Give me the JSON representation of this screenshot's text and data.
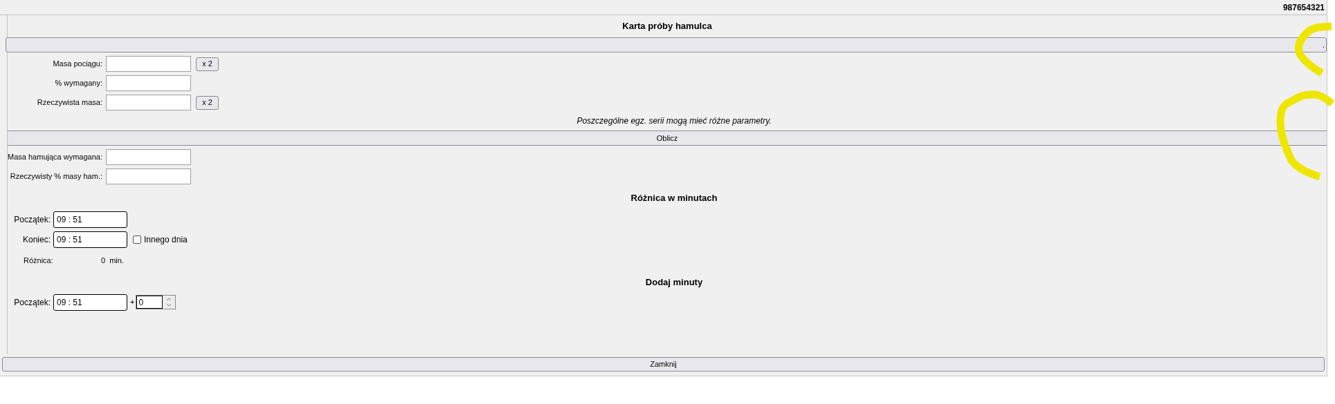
{
  "version": "987654321",
  "title": "Karta próby hamulca",
  "top_button": {
    "label": "."
  },
  "mass_fields": [
    {
      "label": "Masa pociągu:",
      "double_button": "x 2"
    },
    {
      "label": "% wymagany:"
    },
    {
      "label": "Rzeczywista masa:",
      "double_button": "x 2"
    }
  ],
  "note": "Poszczególne egz. serii mogą mieć różne parametry.",
  "calculate_button": "Oblicz",
  "result_fields": [
    {
      "label": "Masa hamująca wymagana:"
    },
    {
      "label": "Rzeczywisty % masy ham.:"
    }
  ],
  "difference": {
    "heading": "Różnica w minutach",
    "start": {
      "label": "Początek:",
      "value": "09 : 51"
    },
    "end": {
      "label": "Koniec:",
      "value": "09 : 51"
    },
    "other_day": {
      "label": "Innego dnia",
      "checked": false
    },
    "result_label": "Różnica:",
    "result_value": "0",
    "result_unit": "min."
  },
  "add_minutes": {
    "heading": "Dodaj minuty",
    "start": {
      "label": "Początek:",
      "value": "09 : 51"
    },
    "plus": "+",
    "minutes": "0"
  },
  "close_button": "Zamknij"
}
